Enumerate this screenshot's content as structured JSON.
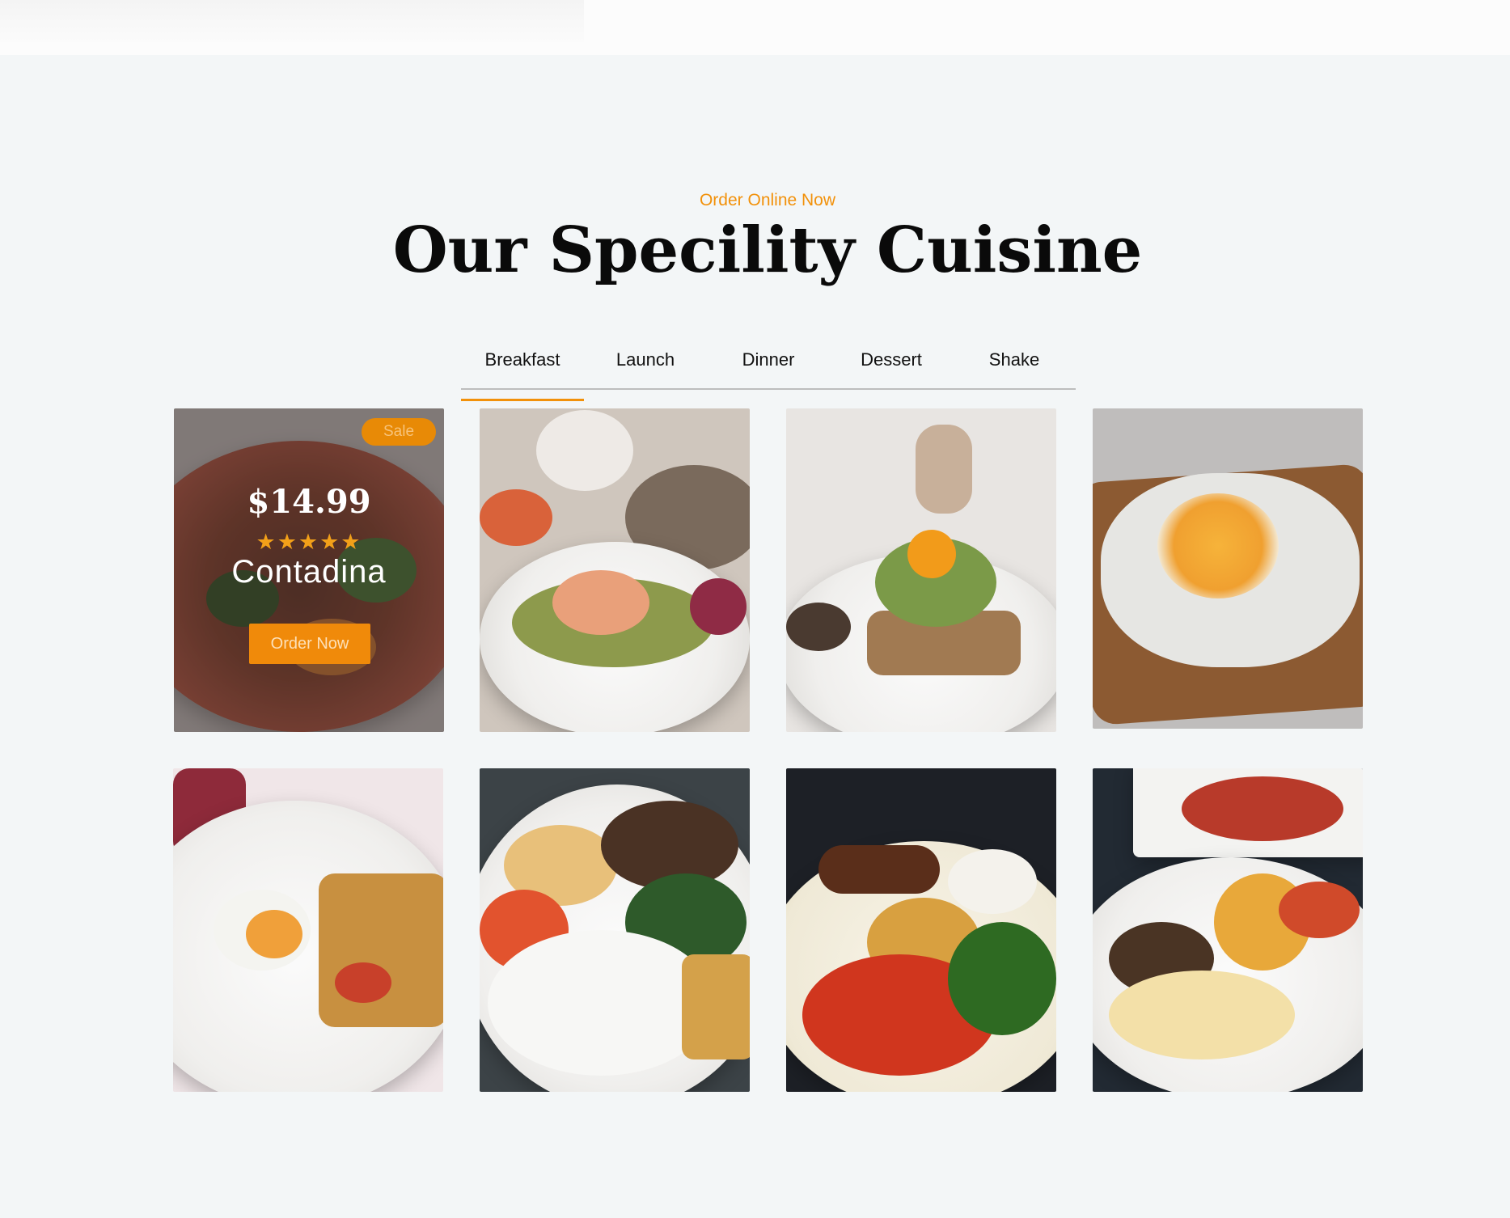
{
  "section": {
    "subtitle": "Order Online Now",
    "title": "Our Specility Cuisine"
  },
  "tabs": [
    {
      "label": "Breakfast",
      "active": true
    },
    {
      "label": "Launch",
      "active": false
    },
    {
      "label": "Dinner",
      "active": false
    },
    {
      "label": "Dessert",
      "active": false
    },
    {
      "label": "Shake",
      "active": false
    }
  ],
  "featured": {
    "badge": "Sale",
    "price": "$14.99",
    "rating": 5,
    "stars": "★★★★★",
    "name": "Contadina",
    "button": "Order Now"
  },
  "colors": {
    "accent": "#f2910a",
    "background": "#f3f6f7",
    "title": "#0a0a0a"
  }
}
